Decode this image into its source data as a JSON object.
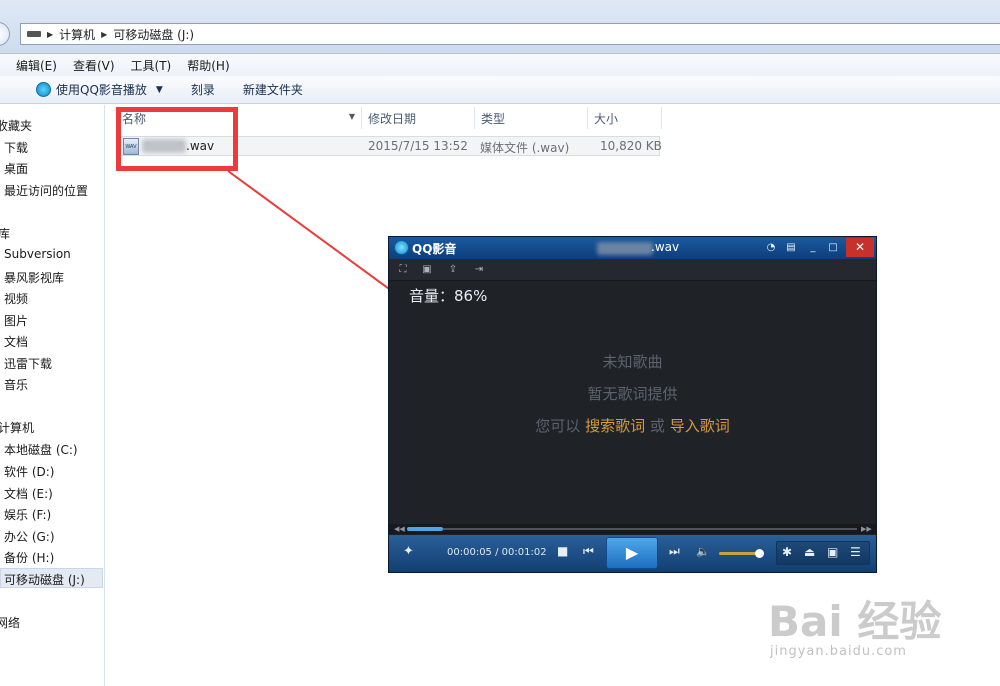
{
  "address": {
    "crumbs": [
      "计算机",
      "可移动磁盘 (J:)"
    ]
  },
  "menu": [
    "编辑(E)",
    "查看(V)",
    "工具(T)",
    "帮助(H)"
  ],
  "toolbar": {
    "play_with": "使用QQ影音播放",
    "burn": "刻录",
    "new_folder": "新建文件夹"
  },
  "nav": {
    "favorites": "收藏夹",
    "downloads": "下载",
    "desktop": "桌面",
    "recent": "最近访问的位置",
    "libraries": "库",
    "lib_subversion": "Subversion",
    "lib_storm": "暴风影视库",
    "lib_video": "视频",
    "lib_pictures": "图片",
    "lib_docs": "文档",
    "lib_thunder": "迅雷下载",
    "lib_music": "音乐",
    "computer": "计算机",
    "drive_c": "本地磁盘 (C:)",
    "drive_d": "软件 (D:)",
    "drive_e": "文档 (E:)",
    "drive_f": "娱乐 (F:)",
    "drive_g": "办公 (G:)",
    "drive_h": "备份 (H:)",
    "drive_j": "可移动磁盘 (J:)",
    "network": "网络"
  },
  "columns": {
    "name": "名称",
    "modified": "修改日期",
    "type": "类型",
    "size": "大小"
  },
  "file": {
    "name_suffix": ".wav",
    "icon_label": "WAV",
    "modified": "2015/7/15 13:52",
    "type": "媒体文件 (.wav)",
    "size": "10,820 KB"
  },
  "player": {
    "app_name": "QQ影音",
    "title_suffix": ".wav",
    "volume": "音量：86%",
    "volume_level": 0.86,
    "song": "未知歌曲",
    "no_lyrics": "暂无歌词提供",
    "hint_prefix": "您可以",
    "search_lyrics": "搜索歌词",
    "or": "或",
    "import_lyrics": "导入歌词",
    "time": "00:00:05 / 00:01:02",
    "progress": 0.08
  },
  "watermark": {
    "brand": "Bai 经验",
    "url": "jingyan.baidu.com"
  },
  "colors": {
    "annotation_red": "#ec3b3b",
    "lyric_link": "#d89a3a",
    "player_accent": "#1c6fc0"
  }
}
